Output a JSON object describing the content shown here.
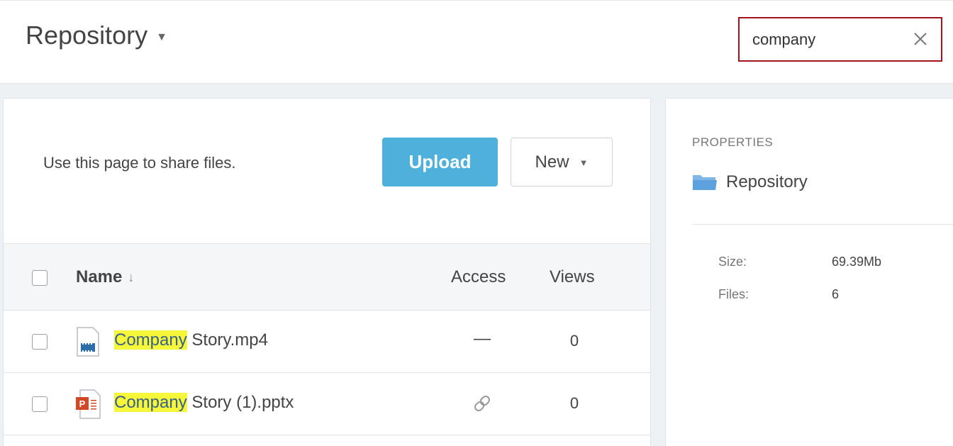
{
  "header": {
    "title": "Repository",
    "search_value": "company"
  },
  "main": {
    "intro_text": "Use this page to share files.",
    "upload_label": "Upload",
    "new_label": "New",
    "columns": {
      "name": "Name",
      "access": "Access",
      "views": "Views"
    },
    "rows": [
      {
        "highlight": "Company",
        "rest": " Story.mp4",
        "type_icon": "video-file-icon",
        "access": "—",
        "views": "0"
      },
      {
        "highlight": "Company",
        "rest": " Story (1).pptx",
        "type_icon": "powerpoint-file-icon",
        "access_icon": "link-icon",
        "views": "0"
      }
    ]
  },
  "properties": {
    "label": "PROPERTIES",
    "folder_name": "Repository",
    "size_label": "Size:",
    "size_value": "69.39Mb",
    "files_label": "Files:",
    "files_value": "6"
  },
  "colors": {
    "accent": "#4fb0db",
    "search_border": "#a2131c",
    "highlight": "#f7f73a"
  }
}
